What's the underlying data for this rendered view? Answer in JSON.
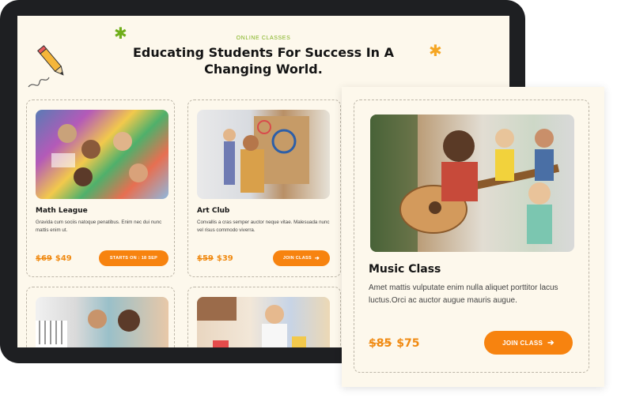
{
  "header": {
    "eyebrow": "ONLINE CLASSES",
    "title": "Educating Students For Success In A Changing World."
  },
  "colors": {
    "accent": "#f7830f",
    "eyebrow_green": "#7fb11b",
    "background": "#fdf8ec",
    "star_green": "#6fae1a",
    "star_orange": "#f5a623"
  },
  "decorations": {
    "pencil_icon": "pencil-icon",
    "star_icon": "star-icon"
  },
  "cards": [
    {
      "title": "Math League",
      "description": "Gravida cum sociis natoque penatibus. Enim nec dui nunc mattis enim ut.",
      "old_price": "$69",
      "price": "$49",
      "button_label": "STARTS ON : 18 SEP",
      "photo_icon": "classroom-photo"
    },
    {
      "title": "Art Club",
      "description": "Convallis a cras semper auctor neque vitae. Malesuada nunc vel risus commodo viverra.",
      "old_price": "$59",
      "price": "$39",
      "button_label": "JOIN CLASS",
      "photo_icon": "art-photo"
    },
    {
      "photo_icon": "piano-photo"
    },
    {
      "photo_icon": "playroom-photo"
    }
  ],
  "featured": {
    "title": "Music Class",
    "description": "Amet mattis vulputate enim nulla aliquet porttitor lacus luctus.Orci ac auctor augue mauris augue.",
    "old_price": "$85",
    "price": "$75",
    "button_label": "JOIN CLASS",
    "photo_icon": "guitar-photo"
  }
}
